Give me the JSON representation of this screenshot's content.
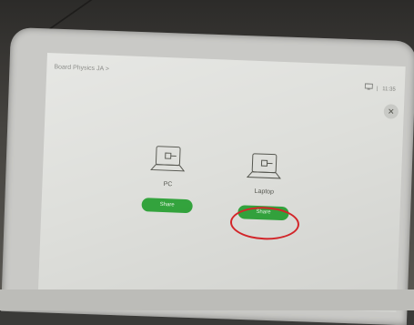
{
  "header": {
    "room_name": "Board Physics JA >",
    "status_icon": "screen-share-icon",
    "time": "11:35"
  },
  "close": {
    "icon": "close-icon",
    "glyph": "✕"
  },
  "sources": [
    {
      "label": "PC",
      "button_label": "Share",
      "icon": "laptop-icon"
    },
    {
      "label": "Laptop",
      "button_label": "Share",
      "icon": "laptop-icon"
    }
  ],
  "colors": {
    "share_button": "#33a43d",
    "highlight_ring": "#d7262a",
    "screen_bg": "#dedfdb"
  }
}
